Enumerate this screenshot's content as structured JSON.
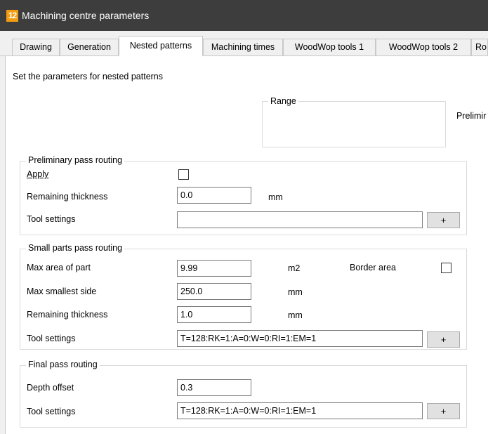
{
  "window": {
    "icon_text": "12",
    "title": "Machining centre parameters"
  },
  "tabs": [
    {
      "label": "Drawing",
      "active": false
    },
    {
      "label": "Generation",
      "active": false
    },
    {
      "label": "Nested patterns",
      "active": true
    },
    {
      "label": "Machining times",
      "active": false
    },
    {
      "label": "WoodWop tools 1",
      "active": false
    },
    {
      "label": "WoodWop tools 2",
      "active": false
    },
    {
      "label": "Ro",
      "active": false
    }
  ],
  "intro": "Set the parameters for nested patterns",
  "range": {
    "legend": "Range",
    "side_label": "Prelimir"
  },
  "preliminary": {
    "legend": "Preliminary pass routing",
    "apply_label": "Apply",
    "apply_checked": false,
    "remaining_label": "Remaining thickness",
    "remaining_value": "0.0",
    "remaining_unit": "mm",
    "tool_label": "Tool settings",
    "tool_value": "",
    "tool_button": "+"
  },
  "small_parts": {
    "legend": "Small parts pass routing",
    "max_area_label": "Max area of part",
    "max_area_value": "9.99",
    "max_area_unit": "m2",
    "border_label": "Border area",
    "border_checked": false,
    "max_side_label": "Max smallest side",
    "max_side_value": "250.0",
    "max_side_unit": "mm",
    "remaining_label": "Remaining thickness",
    "remaining_value": "1.0",
    "remaining_unit": "mm",
    "tool_label": "Tool settings",
    "tool_value": "T=128:RK=1:A=0:W=0:RI=1:EM=1",
    "tool_button": "+"
  },
  "final": {
    "legend": "Final pass routing",
    "depth_label": "Depth offset",
    "depth_value": "0.3",
    "tool_label": "Tool settings",
    "tool_value": "T=128:RK=1:A=0:W=0:RI=1:EM=1",
    "tool_button": "+"
  }
}
